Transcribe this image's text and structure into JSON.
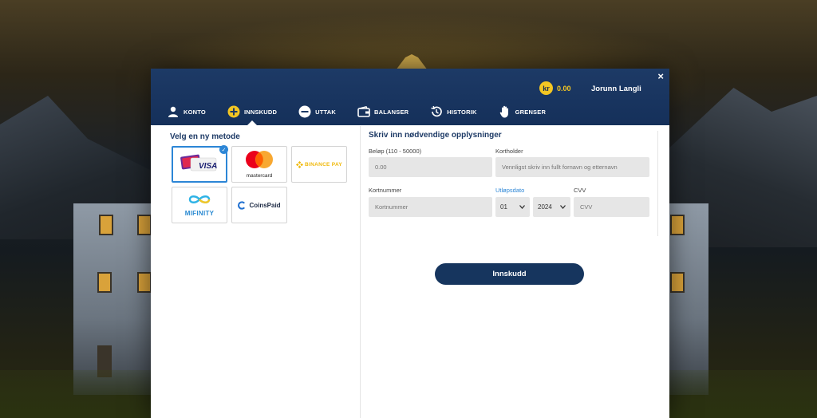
{
  "header": {
    "close_label": "×",
    "currency_symbol": "kr",
    "balance": "0.00",
    "username": "Jorunn Langli"
  },
  "tabs": [
    {
      "label": "KONTO",
      "icon": "user-icon"
    },
    {
      "label": "INNSKUDD",
      "icon": "plus-circle-icon",
      "active": true
    },
    {
      "label": "UTTAK",
      "icon": "minus-circle-icon"
    },
    {
      "label": "BALANSER",
      "icon": "wallet-icon"
    },
    {
      "label": "HISTORIK",
      "icon": "history-icon"
    },
    {
      "label": "GRENSER",
      "icon": "hand-icon"
    }
  ],
  "payment": {
    "title": "Velg en ny metode",
    "methods": [
      {
        "label": "VISA",
        "icon": "visa-card-icon",
        "selected": true
      },
      {
        "label": "mastercard",
        "icon": "mastercard-icon"
      },
      {
        "label": "BINANCE PAY",
        "icon": "binance-pay-icon"
      },
      {
        "label": "MIFINITY",
        "icon": "mifinity-icon"
      },
      {
        "label": "CoinsPaid",
        "icon": "coinspaid-icon"
      }
    ]
  },
  "form": {
    "title": "Skriv inn nødvendige opplysninger",
    "amount_label": "Beløp (110 - 50000)",
    "amount_placeholder": "0.00",
    "holder_label": "Kortholder",
    "holder_placeholder": "Vennligst skriv inn fullt fornavn og etternavn",
    "card_label": "Kortnummer",
    "card_placeholder": "Kortnummer",
    "expiry_label": "Utløpsdato",
    "expiry_month": "01",
    "expiry_year": "2024",
    "cvv_label": "CVV",
    "cvv_placeholder": "CVV",
    "submit_label": "Innskudd"
  },
  "colors": {
    "header_bg": "#1d3a66",
    "accent_blue": "#2c86d6",
    "coin_yellow": "#f3c623",
    "button_bg": "#16355e"
  }
}
